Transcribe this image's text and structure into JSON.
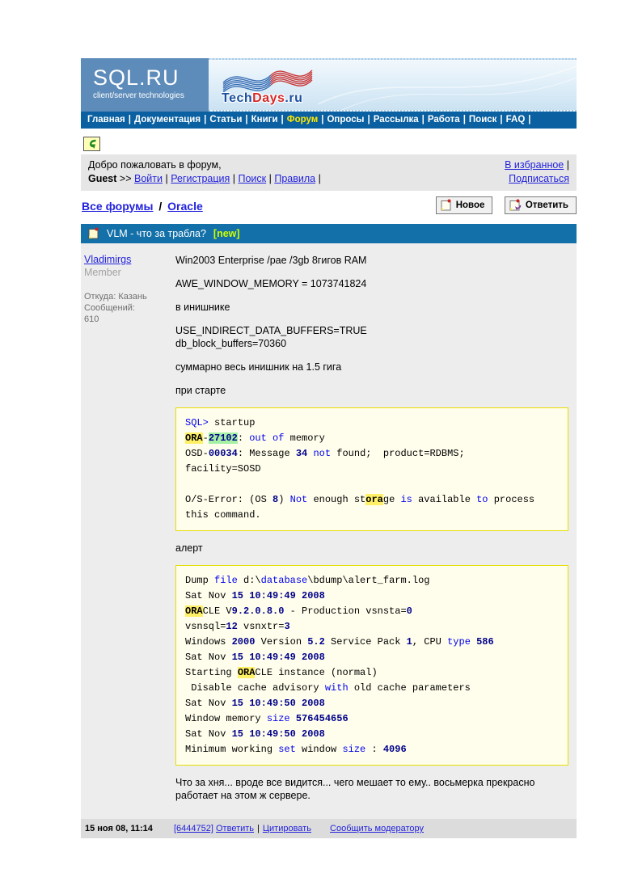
{
  "header": {
    "logo_title": "SQL.RU",
    "logo_subtitle": "client/server technologies",
    "banner": {
      "t1": "Tech",
      "t2": "Days",
      "t3": ".ru"
    },
    "nav_items": [
      "Главная",
      "Документация",
      "Статьи",
      "Книги",
      "Форум",
      "Опросы",
      "Рассылка",
      "Работа",
      "Поиск",
      "FAQ"
    ],
    "nav_active": "Форум"
  },
  "userbar": {
    "welcome": "Добро пожаловать в форум,",
    "username": "Guest",
    "arrows": ">>",
    "links": [
      "Войти",
      "Регистрация",
      "Поиск",
      "Правила"
    ],
    "favorites": "В избранное",
    "subscribe": "Подписаться"
  },
  "breadcrumb": {
    "root": "Все форумы",
    "separator": "/",
    "current": "Oracle"
  },
  "actions": {
    "new_label": "Новое",
    "reply_label": "Ответить"
  },
  "topic": {
    "title": "VLM - что за трабла?",
    "badge": "[new]"
  },
  "post": {
    "author": "Vladimirgs",
    "role": "Member",
    "origin": "Откуда: Казань",
    "messages_label": "Сообщений:",
    "messages_count": "610",
    "paragraphs": [
      [
        "Win2003 Enterprise /pae /3gb 8гигов RAM"
      ],
      [
        "AWE_WINDOW_MEMORY = 1073741824"
      ],
      [
        "в инишнике"
      ],
      [
        "USE_INDIRECT_DATA_BUFFERS=TRUE",
        "db_block_buffers=70360"
      ],
      [
        "суммарно весь инишник на 1.5 гига"
      ],
      [
        "при старте"
      ]
    ],
    "code_block_1": [
      [
        [
          "SQL>",
          "k"
        ],
        [
          " startup",
          ""
        ]
      ],
      [
        [
          "ORA",
          "hy"
        ],
        [
          "-",
          ""
        ],
        [
          "27102",
          "hg"
        ],
        [
          ": ",
          ""
        ],
        [
          "out",
          "k"
        ],
        [
          " ",
          ""
        ],
        [
          "of",
          "k"
        ],
        [
          " memory",
          ""
        ]
      ],
      [
        [
          "OSD-",
          ""
        ],
        [
          "00034",
          "n"
        ],
        [
          ": Message ",
          ""
        ],
        [
          "34",
          "n"
        ],
        [
          " ",
          ""
        ],
        [
          "not",
          "k"
        ],
        [
          " found;  product=RDBMS;",
          ""
        ]
      ],
      [
        [
          "facility=SOSD",
          ""
        ]
      ],
      [],
      [
        [
          "O/S-Error: (OS ",
          ""
        ],
        [
          "8",
          "n"
        ],
        [
          ") ",
          ""
        ],
        [
          "Not",
          "k"
        ],
        [
          " enough st",
          ""
        ],
        [
          "ora",
          "hy"
        ],
        [
          "ge ",
          ""
        ],
        [
          "is",
          "k"
        ],
        [
          " available ",
          ""
        ],
        [
          "to",
          "k"
        ],
        [
          " process",
          ""
        ]
      ],
      [
        [
          "this command.",
          ""
        ]
      ]
    ],
    "alert_label": "алерт",
    "code_block_2": [
      [
        [
          "Dump ",
          ""
        ],
        [
          "file",
          "k"
        ],
        [
          " d:\\",
          ""
        ],
        [
          "database",
          "k"
        ],
        [
          "\\bdump\\alert_farm.log",
          ""
        ]
      ],
      [
        [
          "Sat Nov ",
          ""
        ],
        [
          "15 10:49:49 2008",
          "n"
        ]
      ],
      [
        [
          "ORA",
          "hy"
        ],
        [
          "CLE V",
          ""
        ],
        [
          "9.2.0.8.0",
          "n"
        ],
        [
          " - Production vsnsta=",
          ""
        ],
        [
          "0",
          "n"
        ]
      ],
      [
        [
          "vsnsql=",
          ""
        ],
        [
          "12",
          "n"
        ],
        [
          " vsnxtr=",
          ""
        ],
        [
          "3",
          "n"
        ]
      ],
      [
        [
          "Windows ",
          ""
        ],
        [
          "2000",
          "n"
        ],
        [
          " Version ",
          ""
        ],
        [
          "5.2",
          "n"
        ],
        [
          " Service Pack ",
          ""
        ],
        [
          "1",
          "n"
        ],
        [
          ", CPU ",
          ""
        ],
        [
          "type",
          "k"
        ],
        [
          " ",
          ""
        ],
        [
          "586",
          "n"
        ]
      ],
      [
        [
          "Sat Nov ",
          ""
        ],
        [
          "15 10:49:49 2008",
          "n"
        ]
      ],
      [
        [
          "Starting ",
          ""
        ],
        [
          "ORA",
          "hy"
        ],
        [
          "CLE instance (normal)",
          ""
        ]
      ],
      [
        [
          " Disable cache advisory ",
          ""
        ],
        [
          "with",
          "k"
        ],
        [
          " old cache parameters",
          ""
        ]
      ],
      [
        [
          "Sat Nov ",
          ""
        ],
        [
          "15 10:49:50 2008",
          "n"
        ]
      ],
      [
        [
          "Window memory ",
          ""
        ],
        [
          "size",
          "k"
        ],
        [
          " ",
          ""
        ],
        [
          "576454656",
          "n"
        ]
      ],
      [
        [
          "Sat Nov ",
          ""
        ],
        [
          "15 10:49:50 2008",
          "n"
        ]
      ],
      [
        [
          "Minimum working ",
          ""
        ],
        [
          "set",
          "k"
        ],
        [
          " window ",
          ""
        ],
        [
          "size",
          "k"
        ],
        [
          " : ",
          ""
        ],
        [
          "4096",
          "n"
        ]
      ]
    ],
    "closing": "Что за хня... вроде все видится... чего мешает то ему.. восьмерка прекрасно работает на этом ж сервере.",
    "footer": {
      "date": "15 ноя 08, 11:14",
      "id": "[6444752]",
      "reply": "Ответить",
      "sep": "|",
      "quote": "Цитировать",
      "report": "Сообщить модератору"
    }
  },
  "colors": {
    "logo_bg": "#5E8CBA",
    "nav_bg": "#0A60A0",
    "topic_bg": "#1470A8",
    "link": "#2222DD",
    "badge": "#CCFF00",
    "code_bg": "#FFFEEC",
    "code_border": "#E6DE00",
    "keyword": "#0000EE",
    "number": "#00008B",
    "highlight_yellow": "#FFF066",
    "highlight_green": "#A6F0A6",
    "post_bg": "#EDEDED",
    "bar_bg": "#E6E6E6",
    "footer_bg": "#DCDCDC"
  }
}
